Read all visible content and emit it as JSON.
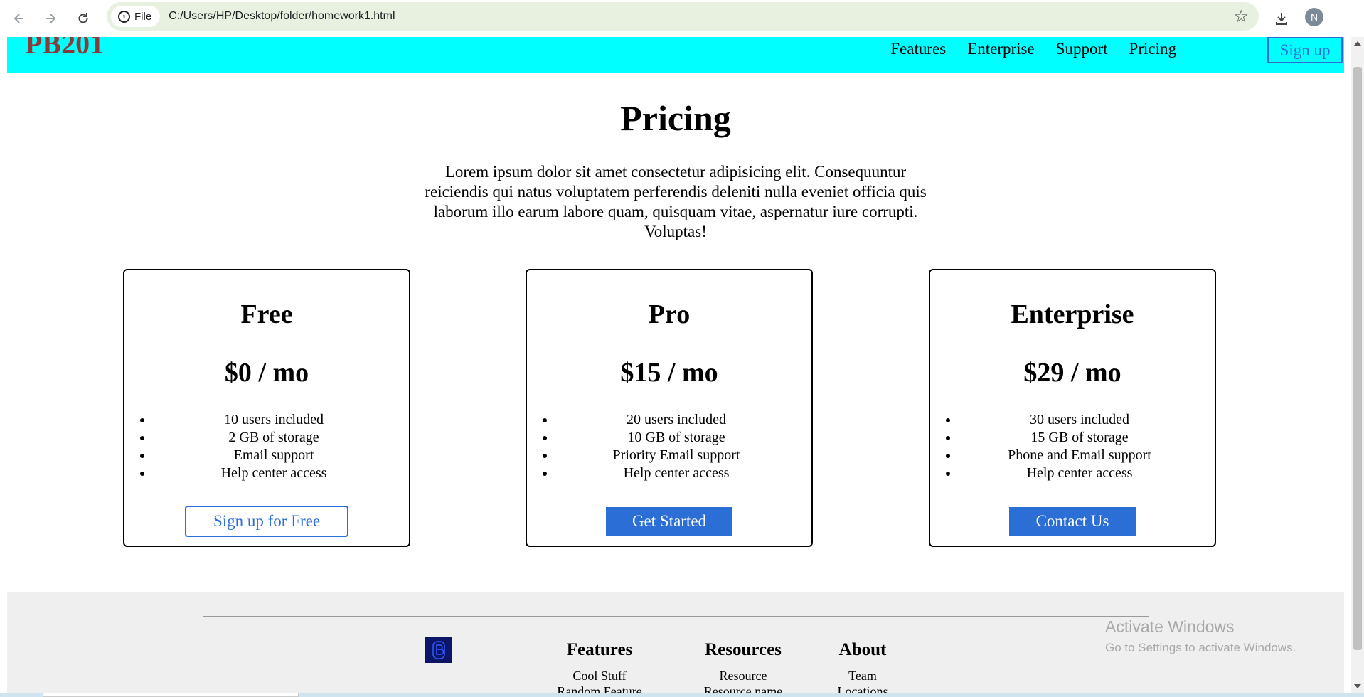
{
  "browser": {
    "site_chip_label": "File",
    "url": "C:/Users/HP/Desktop/folder/homework1.html",
    "avatar_initial": "N",
    "icons": [
      "back-icon",
      "forward-icon",
      "reload-icon",
      "info-icon",
      "star-icon",
      "download-icon"
    ]
  },
  "navbar": {
    "brand": "PB201",
    "links": [
      "Features",
      "Enterprise",
      "Support",
      "Pricing"
    ],
    "signup_label": "Sign up",
    "background": "#00ffff",
    "brand_color": "#8b3a3a"
  },
  "hero": {
    "title": "Pricing",
    "description": "Lorem ipsum dolor sit amet consectetur adipisicing elit. Consequuntur reiciendis qui natus voluptatem perferendis deleniti nulla eveniet officia quis laborum illo earum labore quam, quisquam vitae, aspernatur iure corrupti. Voluptas!"
  },
  "plans": [
    {
      "name": "Free",
      "price": "$0 / mo",
      "features": [
        "10 users included",
        "2 GB of storage",
        "Email support",
        "Help center access"
      ],
      "button": "Sign up for Free"
    },
    {
      "name": "Pro",
      "price": "$15 / mo",
      "features": [
        "20 users included",
        "10 GB of storage",
        "Priority Email support",
        "Help center access"
      ],
      "button": "Get Started"
    },
    {
      "name": "Enterprise",
      "price": "$29 / mo",
      "features": [
        "30 users included",
        "15 GB of storage",
        "Phone and Email support",
        "Help center access"
      ],
      "button": "Contact Us"
    }
  ],
  "footer": {
    "columns": [
      {
        "heading": "Features",
        "links": [
          "Cool Stuff",
          "Random Feature"
        ]
      },
      {
        "heading": "Resources",
        "links": [
          "Resource",
          "Resource name"
        ]
      },
      {
        "heading": "About",
        "links": [
          "Team",
          "Locations"
        ]
      }
    ]
  },
  "watermark": {
    "title": "Activate Windows",
    "subtitle": "Go to Settings to activate Windows."
  },
  "colors": {
    "accent": "#2b6fd6",
    "footer_bg": "#efefef"
  }
}
